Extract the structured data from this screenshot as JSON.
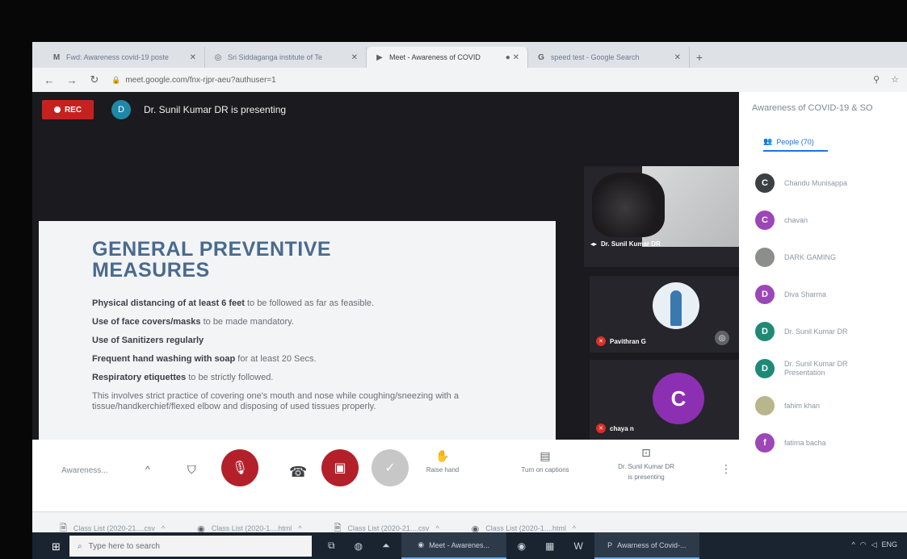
{
  "browser": {
    "tabs": [
      {
        "icon": "gmail-icon",
        "glyph": "M",
        "label": "Fwd: Awareness covid-19 poste",
        "active": false
      },
      {
        "icon": "globe-icon",
        "glyph": "◎",
        "label": "Sri Siddaganga institute of Te",
        "active": false
      },
      {
        "icon": "meet-icon",
        "glyph": "▶",
        "label": "Meet - Awareness of COVID",
        "active": true
      },
      {
        "icon": "google-icon",
        "glyph": "G",
        "label": "speed test - Google Search",
        "active": false
      }
    ],
    "new_tab_label": "+",
    "url": "meet.google.com/fnx-rjpr-aeu?authuser=1"
  },
  "meet": {
    "rec_label": "REC",
    "presenter_initial": "D",
    "presenting_text": "Dr. Sunil Kumar DR is presenting",
    "slide": {
      "title_line1": "GENERAL PREVENTIVE",
      "title_line2": "MEASURES",
      "points": [
        {
          "bold": "Physical distancing of at least 6 feet",
          "rest": " to be followed as far as feasible."
        },
        {
          "bold": "Use of face covers/masks",
          "rest": " to be made mandatory."
        },
        {
          "bold": "Use of Sanitizers regularly",
          "rest": ""
        },
        {
          "bold": "Frequent hand washing with soap",
          "rest": " for at least 20 Secs."
        },
        {
          "bold": "Respiratory etiquettes",
          "rest": " to be strictly followed."
        }
      ],
      "note": "This involves strict practice of covering one's mouth and nose while coughing/sneezing with a tissue/handkerchief/flexed elbow and disposing of used tissues properly."
    },
    "tiles": [
      {
        "name": "Dr. Sunil Kumar DR",
        "type": "video"
      },
      {
        "name": "Pavithran G",
        "type": "photo"
      },
      {
        "name": "chaya n",
        "type": "letter",
        "initial": "C"
      }
    ]
  },
  "panel": {
    "title": "Awareness of COVID-19 & SO",
    "people_tab": "People (70)",
    "people": [
      {
        "name": "Chandu Munisappa",
        "initial": "C",
        "color": "#3c4043"
      },
      {
        "name": "chavan",
        "initial": "C",
        "color": "#9c46b8"
      },
      {
        "name": "DARK GAMING",
        "initial": "",
        "color": "#8b8f8a"
      },
      {
        "name": "Diva Sharma",
        "initial": "D",
        "color": "#9c46b8"
      },
      {
        "name": "Dr. Sunil Kumar DR",
        "initial": "D",
        "color": "#1e8a76"
      },
      {
        "name": "Dr. Sunil Kumar DR",
        "sub": "Presentation",
        "initial": "D",
        "color": "#1e8a76"
      },
      {
        "name": "fahim khan",
        "initial": "",
        "color": "#b9b58c"
      },
      {
        "name": "fatima bacha",
        "initial": "f",
        "color": "#9c46b8"
      }
    ]
  },
  "controls": {
    "meeting_name": "Awareness...",
    "raise_hand": "Raise hand",
    "captions": "Turn on captions",
    "presenting_line1": "Dr. Sunil Kumar DR",
    "presenting_line2": "is presenting"
  },
  "downloads": [
    {
      "name": "Class List (2020-21....csv"
    },
    {
      "name": "Class List (2020-1....html"
    },
    {
      "name": "Class List (2020-21....csv"
    },
    {
      "name": "Class List (2020-1....html"
    }
  ],
  "taskbar": {
    "search_placeholder": "Type here to search",
    "apps": [
      {
        "label": "Meet - Awarenes..."
      },
      {
        "label": "Awarness of Covid-..."
      }
    ],
    "tray": "ENG"
  }
}
